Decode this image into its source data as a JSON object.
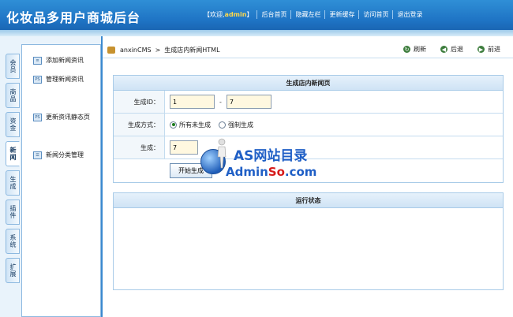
{
  "header": {
    "title": "化妆品多用户商城后台",
    "welcome_prefix": "【欢迎,",
    "user": "admin",
    "welcome_suffix": "】",
    "nav": [
      "后台首页",
      "隐藏左栏",
      "更新缓存",
      "访问首页",
      "退出登录"
    ]
  },
  "left_tabs": [
    "会员",
    "商品",
    "资金",
    "新闻",
    "生成",
    "插件",
    "系统",
    "扩展"
  ],
  "active_tab": "新闻",
  "side_menu": [
    "添加新闻资讯",
    "管理新闻资讯",
    "更新资讯静态页",
    "新闻分类管理"
  ],
  "breadcrumb": {
    "root": "anxinCMS",
    "sep": ">",
    "current": "生成店内新闻HTML"
  },
  "actions": {
    "refresh": "刷新",
    "back": "后退",
    "forward": "前进"
  },
  "form": {
    "title": "生成店内新闻页",
    "id_label": "生成ID：",
    "id_from": "1",
    "id_dash": "-",
    "id_to": "7",
    "mode_label": "生成方式：",
    "mode_options": [
      "所有未生成",
      "强制生成"
    ],
    "mode_selected": "所有未生成",
    "gen_label": "生成：",
    "gen_value": "7",
    "start_button": "开始生成"
  },
  "status_panel": {
    "title": "运行状态"
  },
  "watermark": {
    "line1": "AS网站目录",
    "line2_a": "Admin",
    "line2_b": "So",
    "line2_c": ".com"
  },
  "colors": {
    "header": "#1e73c4",
    "accent": "#3b8ad0",
    "input_bg": "#fff8e0"
  }
}
